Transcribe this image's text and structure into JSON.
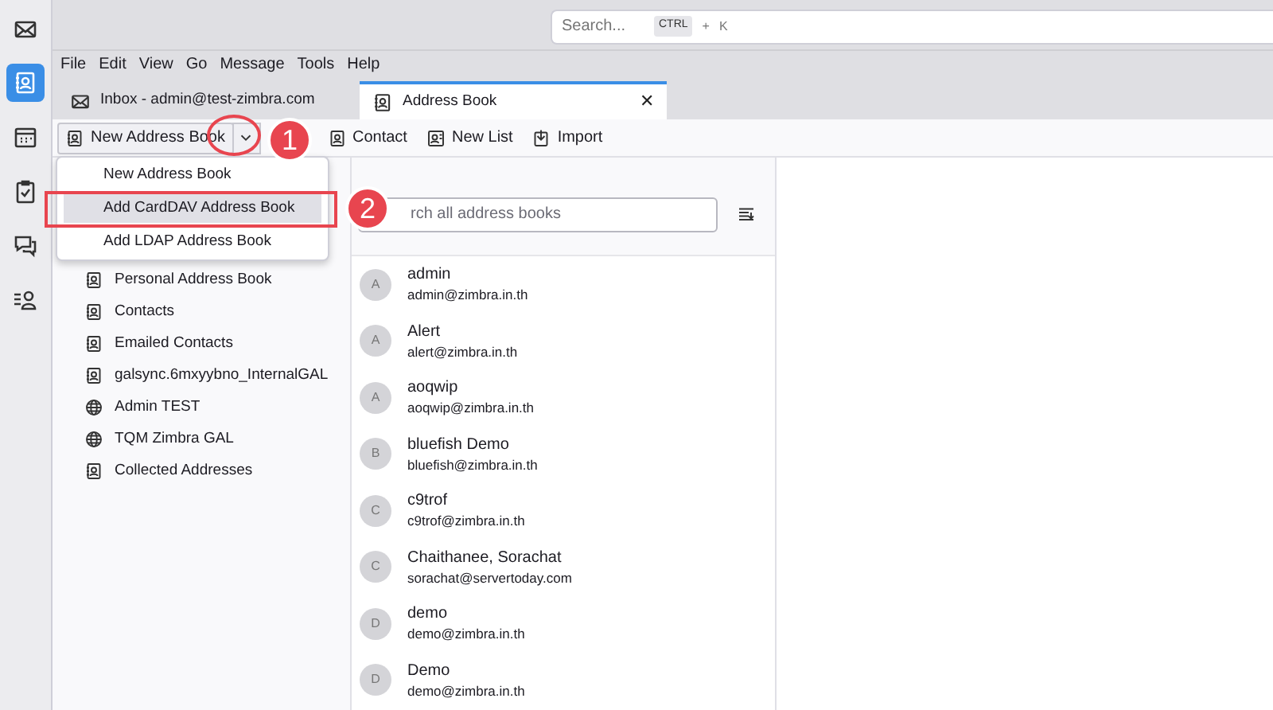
{
  "search": {
    "placeholder": "Search...",
    "keys": [
      "CTRL",
      "+",
      "K"
    ]
  },
  "spaces": [
    {
      "kind": "mail",
      "selected": false
    },
    {
      "kind": "addressbook",
      "selected": true
    },
    {
      "kind": "calendar",
      "selected": false
    },
    {
      "kind": "tasks",
      "selected": false
    },
    {
      "kind": "chat",
      "selected": false
    },
    {
      "kind": "contacts",
      "selected": false
    }
  ],
  "menu": [
    "File",
    "Edit",
    "View",
    "Go",
    "Message",
    "Tools",
    "Help"
  ],
  "tabs": [
    {
      "label": "Inbox - admin@test-zimbra.com",
      "kind": "mail",
      "selected": false
    },
    {
      "label": "Address Book",
      "kind": "addressbook",
      "selected": true,
      "close": "✕"
    }
  ],
  "toolbar": [
    {
      "label": "New Address Book",
      "kind": "split"
    },
    {
      "label": "Contact",
      "kind": "contact"
    },
    {
      "label": "New List",
      "kind": "list"
    },
    {
      "label": "Import",
      "kind": "import"
    }
  ],
  "dropdown": [
    {
      "label": "New Address Book",
      "selected": false
    },
    {
      "label": "Add CardDAV Address Book",
      "selected": true
    },
    {
      "label": "Add LDAP Address Book",
      "selected": false
    }
  ],
  "address_books": [
    {
      "label": "Personal Address Book",
      "kind": "book"
    },
    {
      "label": "Contacts",
      "kind": "book"
    },
    {
      "label": "Emailed Contacts",
      "kind": "book"
    },
    {
      "label": "galsync.6mxyybno_InternalGAL",
      "kind": "book"
    },
    {
      "label": "Admin TEST",
      "kind": "globe"
    },
    {
      "label": "TQM Zimbra GAL",
      "kind": "globe"
    },
    {
      "label": "Collected Addresses",
      "kind": "book"
    }
  ],
  "contact_search": {
    "placeholder": "rch all address books"
  },
  "contacts": [
    {
      "initial": "A",
      "name": "admin",
      "email": "admin@zimbra.in.th"
    },
    {
      "initial": "A",
      "name": "Alert",
      "email": "alert@zimbra.in.th"
    },
    {
      "initial": "A",
      "name": "aoqwip",
      "email": "aoqwip@zimbra.in.th"
    },
    {
      "initial": "B",
      "name": "bluefish Demo",
      "email": "bluefish@zimbra.in.th"
    },
    {
      "initial": "C",
      "name": "c9trof",
      "email": "c9trof@zimbra.in.th"
    },
    {
      "initial": "C",
      "name": "Chaithanee, Sorachat",
      "email": "sorachat@servertoday.com"
    },
    {
      "initial": "D",
      "name": "demo",
      "email": "demo@zimbra.in.th"
    },
    {
      "initial": "D",
      "name": "Demo",
      "email": "demo@zimbra.in.th"
    }
  ],
  "annotations": [
    {
      "number": "1"
    },
    {
      "number": "2"
    }
  ]
}
